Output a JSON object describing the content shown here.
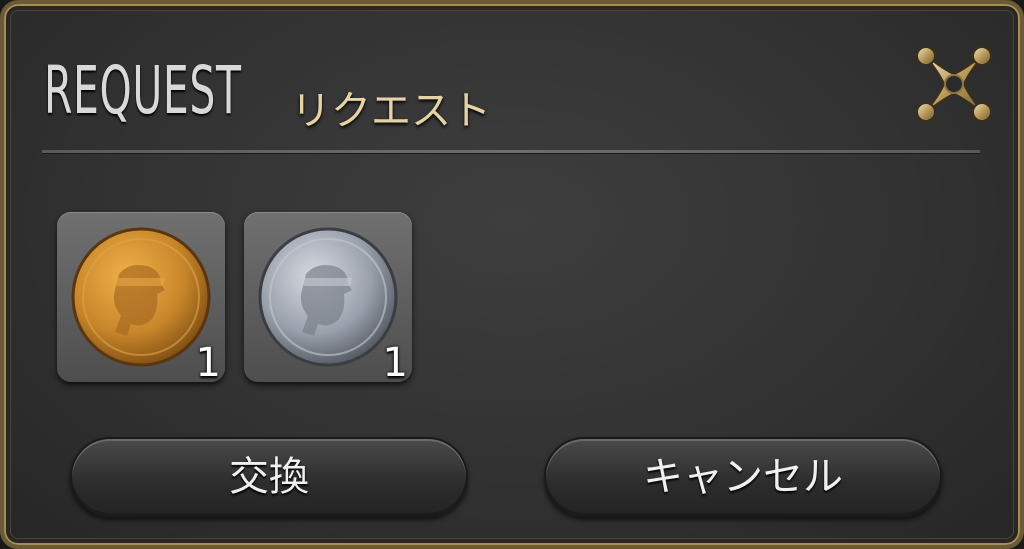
{
  "window": {
    "title": "REQUEST",
    "subtitle": "リクエスト",
    "close_icon": "close-icon"
  },
  "items": [
    {
      "name": "gold-coin-icon",
      "quantity": "1",
      "color": "#c8862a"
    },
    {
      "name": "silver-coin-icon",
      "quantity": "1",
      "color": "#9aa0ab"
    }
  ],
  "buttons": {
    "exchange_label": "交換",
    "cancel_label": "キャンセル"
  },
  "colors": {
    "frame_gold": "#a58f57",
    "title_jp": "#e6d3a5",
    "panel_bg": "#363636"
  }
}
